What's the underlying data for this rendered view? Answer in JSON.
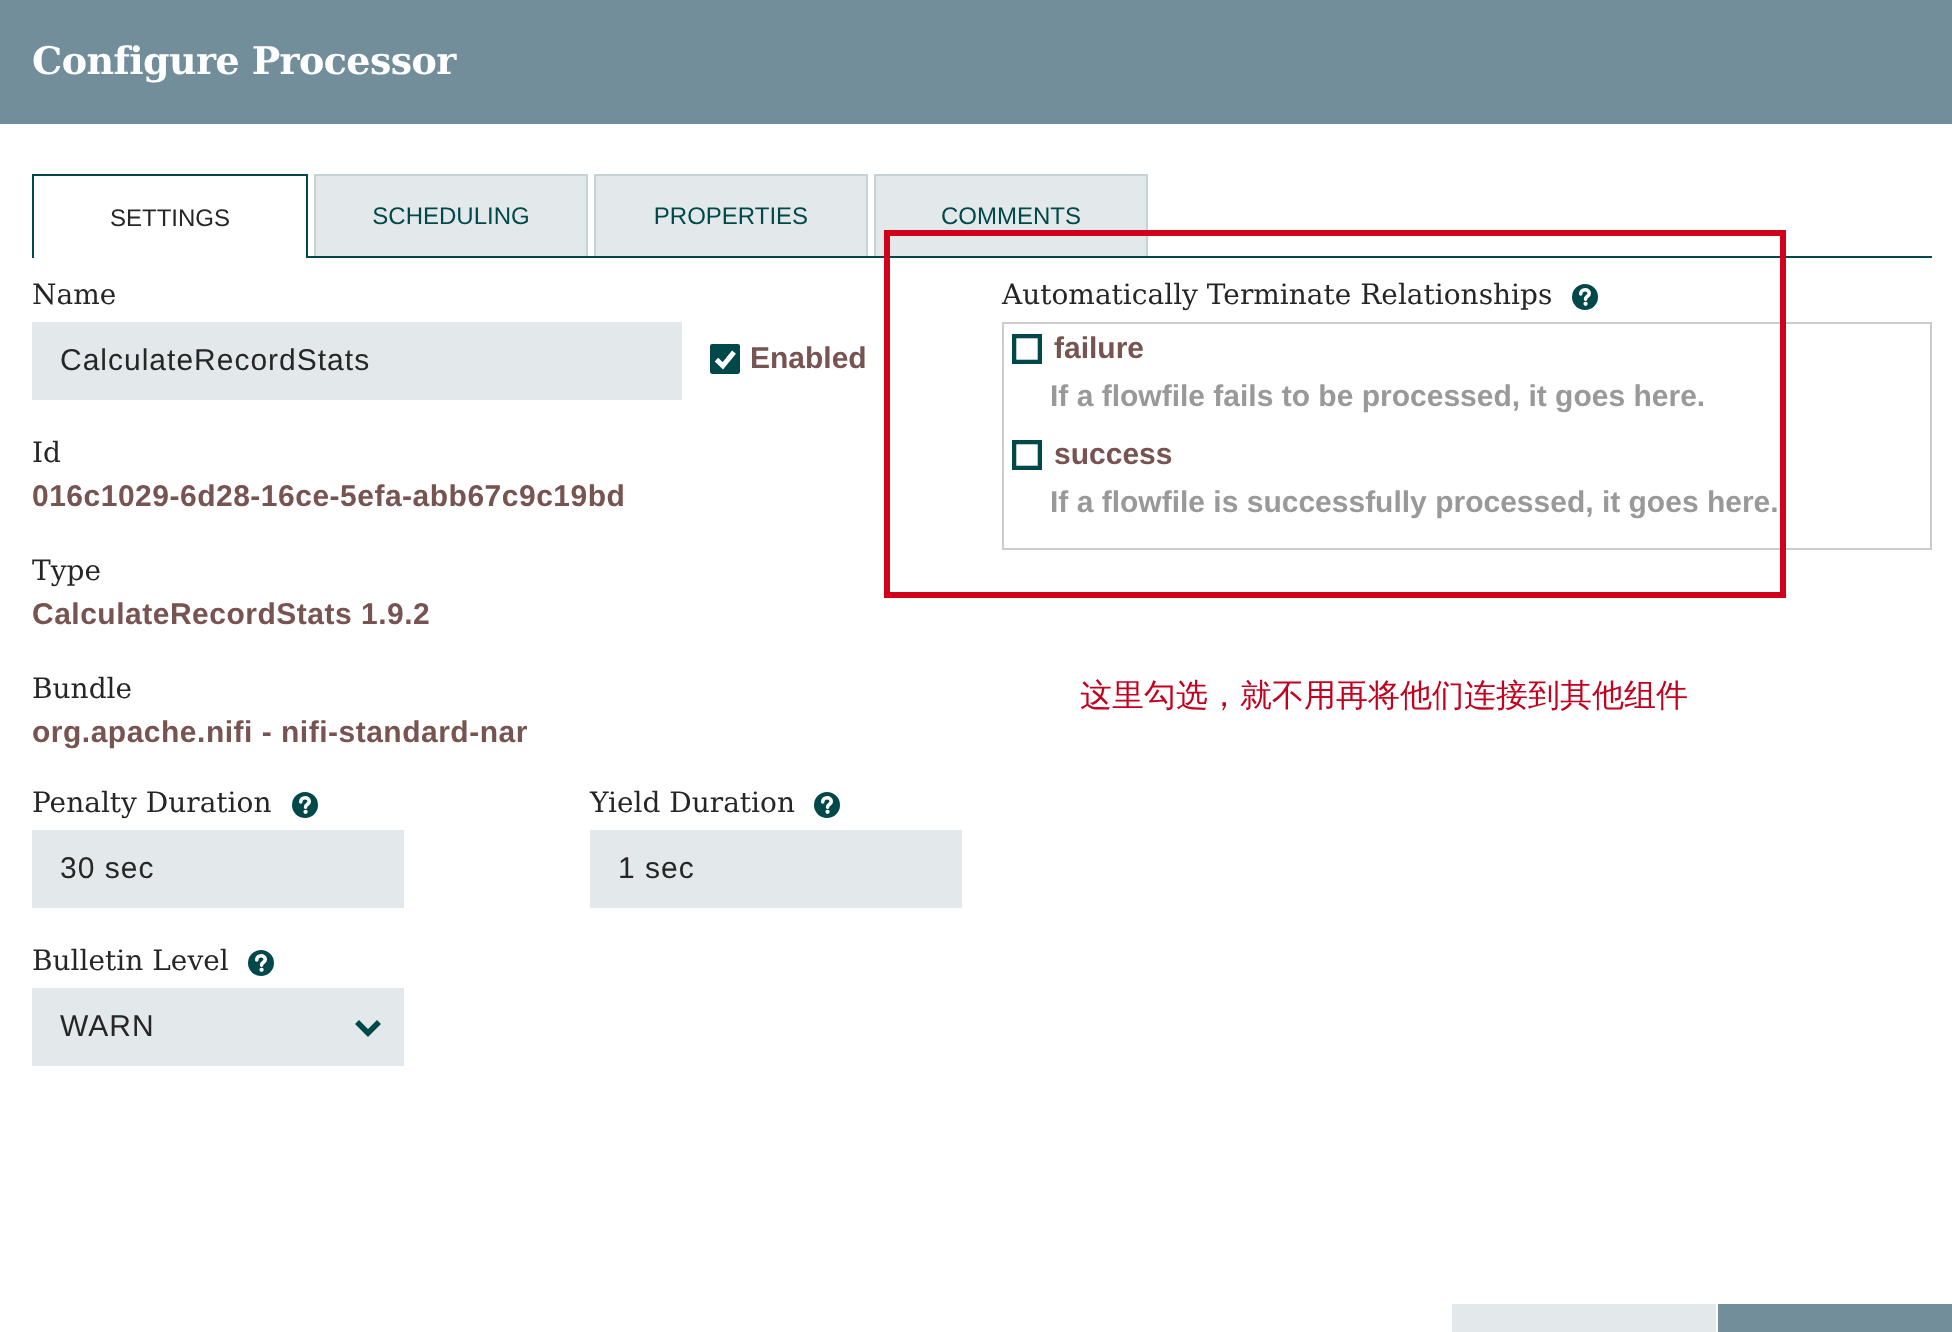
{
  "window": {
    "title": "Configure Processor"
  },
  "tabs": [
    {
      "label": "SETTINGS",
      "selected": true
    },
    {
      "label": "SCHEDULING",
      "selected": false
    },
    {
      "label": "PROPERTIES",
      "selected": false
    },
    {
      "label": "COMMENTS",
      "selected": false
    }
  ],
  "settings": {
    "name": {
      "label": "Name",
      "value": "CalculateRecordStats"
    },
    "enabled": {
      "label": "Enabled",
      "checked": true
    },
    "details": [
      {
        "label": "Id",
        "value": "016c1029-6d28-16ce-5efa-abb67c9c19bd"
      },
      {
        "label": "Type",
        "value": "CalculateRecordStats 1.9.2"
      },
      {
        "label": "Bundle",
        "value": "org.apache.nifi - nifi-standard-nar"
      }
    ],
    "durations": [
      {
        "label": "Penalty Duration",
        "value": "30 sec"
      },
      {
        "label": "Yield Duration",
        "value": "1 sec"
      }
    ],
    "bulletin_level": {
      "label": "Bulletin Level",
      "value": "WARN"
    }
  },
  "relationships": {
    "title": "Automatically Terminate Relationships",
    "items": [
      {
        "name": "failure",
        "checked": false,
        "description": "If a flowfile fails to be processed, it goes here."
      },
      {
        "name": "success",
        "checked": false,
        "description": "If a flowfile is successfully processed, it goes here."
      }
    ]
  },
  "annotation": {
    "text": "这里勾选，就不用再将他们连接到其他组件"
  }
}
